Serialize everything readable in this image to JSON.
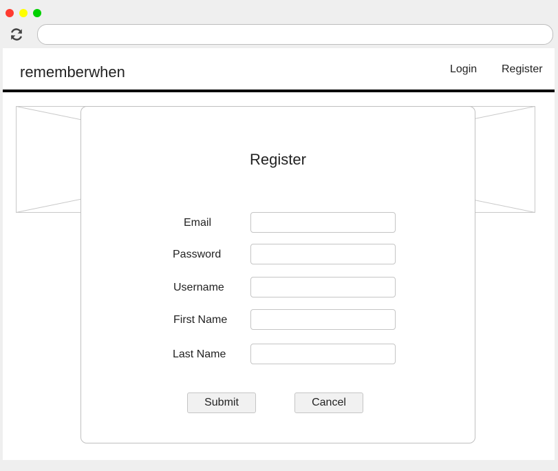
{
  "browser": {
    "traffic_lights": {
      "close": "#ff3b30",
      "minimize": "#ffff00",
      "maximize": "#00d000"
    },
    "reload_icon": "reload-icon",
    "address_bar": {
      "value": ""
    }
  },
  "app": {
    "brand": "rememberwhen",
    "nav": {
      "login": "Login",
      "register": "Register"
    },
    "header_border_color": "#000000"
  },
  "register_modal": {
    "title": "Register",
    "fields": {
      "email": {
        "label": "Email",
        "value": ""
      },
      "password": {
        "label": "Password",
        "value": ""
      },
      "username": {
        "label": "Username",
        "value": ""
      },
      "first_name": {
        "label": "First Name",
        "value": ""
      },
      "last_name": {
        "label": "Last Name",
        "value": ""
      }
    },
    "buttons": {
      "submit": "Submit",
      "cancel": "Cancel"
    }
  },
  "background_image_placeholder": {
    "icon": "image-placeholder-icon"
  }
}
